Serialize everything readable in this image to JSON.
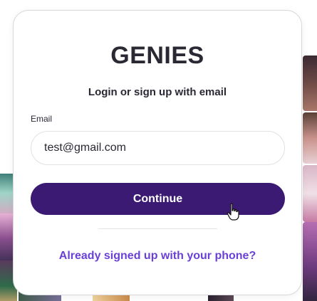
{
  "brand": {
    "logo_text": "GENIES",
    "logo_color": "#2a2833"
  },
  "login": {
    "subtitle": "Login or sign up with email",
    "email_label": "Email",
    "email_value": "test@gmail.com",
    "continue_label": "Continue",
    "phone_link": "Already signed up with your phone?"
  },
  "colors": {
    "primary_button": "#3a1a72",
    "link": "#6b40d6",
    "text": "#2a2833",
    "card_border": "#d7d7dc"
  },
  "icons": {
    "cursor": "hand-pointer-icon"
  }
}
